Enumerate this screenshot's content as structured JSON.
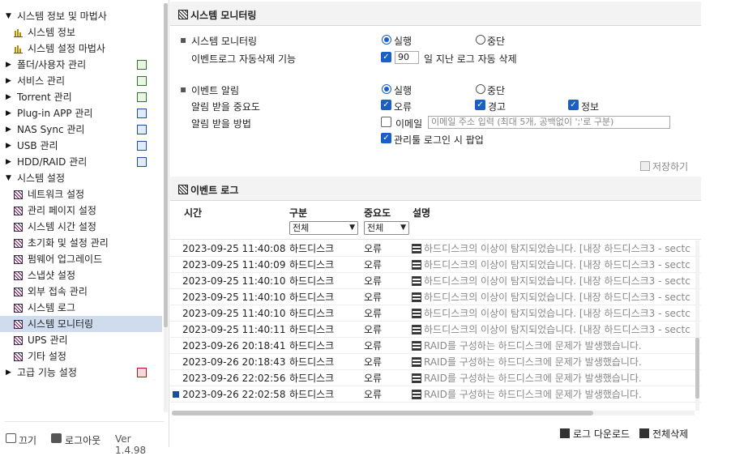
{
  "sidebar": {
    "tree": [
      {
        "label": "시스템 정보 및 마법사",
        "expanded": true,
        "children": [
          "시스템 정보",
          "시스템 설정 마법사"
        ]
      },
      {
        "label": "폴더/사용자 관리"
      },
      {
        "label": "서비스 관리"
      },
      {
        "label": "Torrent 관리"
      },
      {
        "label": "Plug-in APP 관리"
      },
      {
        "label": "NAS Sync 관리"
      },
      {
        "label": "USB 관리"
      },
      {
        "label": "HDD/RAID 관리"
      },
      {
        "label": "시스템 설정",
        "expanded": true,
        "children": [
          "네트워크 설정",
          "관리 페이지 설정",
          "시스템 시간 설정",
          "초기화 및 설정 관리",
          "펌웨어 업그레이드",
          "스냅샷 설정",
          "외부 접속 관리",
          "시스템 로그",
          "시스템 모니터링",
          "UPS 관리",
          "기타 설정"
        ]
      },
      {
        "label": "고급 기능 설정"
      }
    ],
    "selected_item": "시스템 모니터링",
    "footer": {
      "power_label": "끄기",
      "logout_label": "로그아웃",
      "version": "Ver 1.4.98"
    }
  },
  "monitoring": {
    "title": "시스템 모니터링",
    "system_monitoring_label": "시스템 모니터링",
    "auto_delete_label": "이벤트로그 자동삭제 기능",
    "run_label": "실행",
    "stop_label": "중단",
    "monitoring_state": "실행",
    "auto_delete_checked": true,
    "auto_delete_days": "90",
    "auto_delete_suffix": "일 지난 로그 자동 삭제",
    "event_alert_label": "이벤트 알림",
    "event_alert_state": "실행",
    "importance_label": "알림 받을 중요도",
    "importance": {
      "error": "오류",
      "warning": "경고",
      "info": "정보"
    },
    "method_label": "알림 받을 방법",
    "email_label": "이메일",
    "email_checked": false,
    "email_placeholder": "이메일 주소 입력 (최대 5개, 공백없이 ';'로 구분)",
    "popup_label": "관리툴 로그인 시 팝업",
    "popup_checked": true,
    "save_label": "저장하기"
  },
  "event_log": {
    "title": "이벤트 로그",
    "columns": {
      "time": "시간",
      "category": "구분",
      "importance": "중요도",
      "description": "설명"
    },
    "category_filter": "전체",
    "importance_filter": "전체",
    "rows": [
      {
        "time": "2023-09-25 11:40:08",
        "category": "하드디스크",
        "importance": "오류",
        "description": "하드디스크의 이상이 탐지되었습니다. [내장 하드디스크3 - sectc"
      },
      {
        "time": "2023-09-25 11:40:09",
        "category": "하드디스크",
        "importance": "오류",
        "description": "하드디스크의 이상이 탐지되었습니다. [내장 하드디스크3 - sectc"
      },
      {
        "time": "2023-09-25 11:40:10",
        "category": "하드디스크",
        "importance": "오류",
        "description": "하드디스크의 이상이 탐지되었습니다. [내장 하드디스크3 - sectc"
      },
      {
        "time": "2023-09-25 11:40:10",
        "category": "하드디스크",
        "importance": "오류",
        "description": "하드디스크의 이상이 탐지되었습니다. [내장 하드디스크3 - sectc"
      },
      {
        "time": "2023-09-25 11:40:10",
        "category": "하드디스크",
        "importance": "오류",
        "description": "하드디스크의 이상이 탐지되었습니다. [내장 하드디스크3 - sectc"
      },
      {
        "time": "2023-09-25 11:40:11",
        "category": "하드디스크",
        "importance": "오류",
        "description": "하드디스크의 이상이 탐지되었습니다. [내장 하드디스크3 - sectc"
      },
      {
        "time": "2023-09-26 20:18:41",
        "category": "하드디스크",
        "importance": "오류",
        "description": "RAID를 구성하는 하드디스크에 문제가 발생했습니다."
      },
      {
        "time": "2023-09-26 20:18:43",
        "category": "하드디스크",
        "importance": "오류",
        "description": "RAID를 구성하는 하드디스크에 문제가 발생했습니다."
      },
      {
        "time": "2023-09-26 22:02:56",
        "category": "하드디스크",
        "importance": "오류",
        "description": "RAID를 구성하는 하드디스크에 문제가 발생했습니다."
      },
      {
        "time": "2023-09-26 22:02:58",
        "category": "하드디스크",
        "importance": "오류",
        "description": "RAID를 구성하는 하드디스크에 문제가 발생했습니다."
      }
    ],
    "download_label": "로그 다운로드",
    "delete_all_label": "전체삭제"
  }
}
